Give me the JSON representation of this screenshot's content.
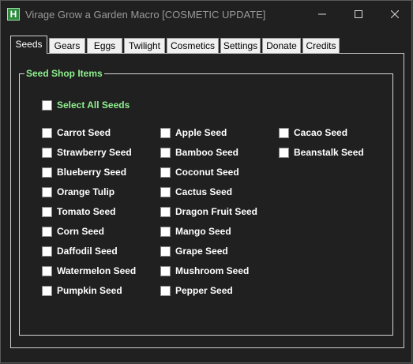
{
  "window": {
    "icon_letter": "H",
    "title": "Virage Grow a Garden Macro [COSMETIC UPDATE]"
  },
  "tabs": [
    "Seeds",
    "Gears",
    "Eggs",
    "Twilight",
    "Cosmetics",
    "Settings",
    "Donate",
    "Credits"
  ],
  "active_tab": "Seeds",
  "group": {
    "title": "Seed Shop Items",
    "select_all_label": "Select All Seeds",
    "select_all_checked": false
  },
  "seeds": {
    "column1": [
      "Carrot Seed",
      "Strawberry Seed",
      "Blueberry Seed",
      "Orange Tulip",
      "Tomato Seed",
      "Corn Seed",
      "Daffodil Seed",
      "Watermelon Seed",
      "Pumpkin Seed"
    ],
    "column2": [
      "Apple Seed",
      "Bamboo Seed",
      "Coconut Seed",
      "Cactus Seed",
      "Dragon Fruit Seed",
      "Mango Seed",
      "Grape Seed",
      "Mushroom Seed",
      "Pepper Seed"
    ],
    "column3": [
      "Cacao Seed",
      "Beanstalk Seed"
    ]
  },
  "colors": {
    "background": "#202020",
    "accent_green": "#8ef08e"
  }
}
